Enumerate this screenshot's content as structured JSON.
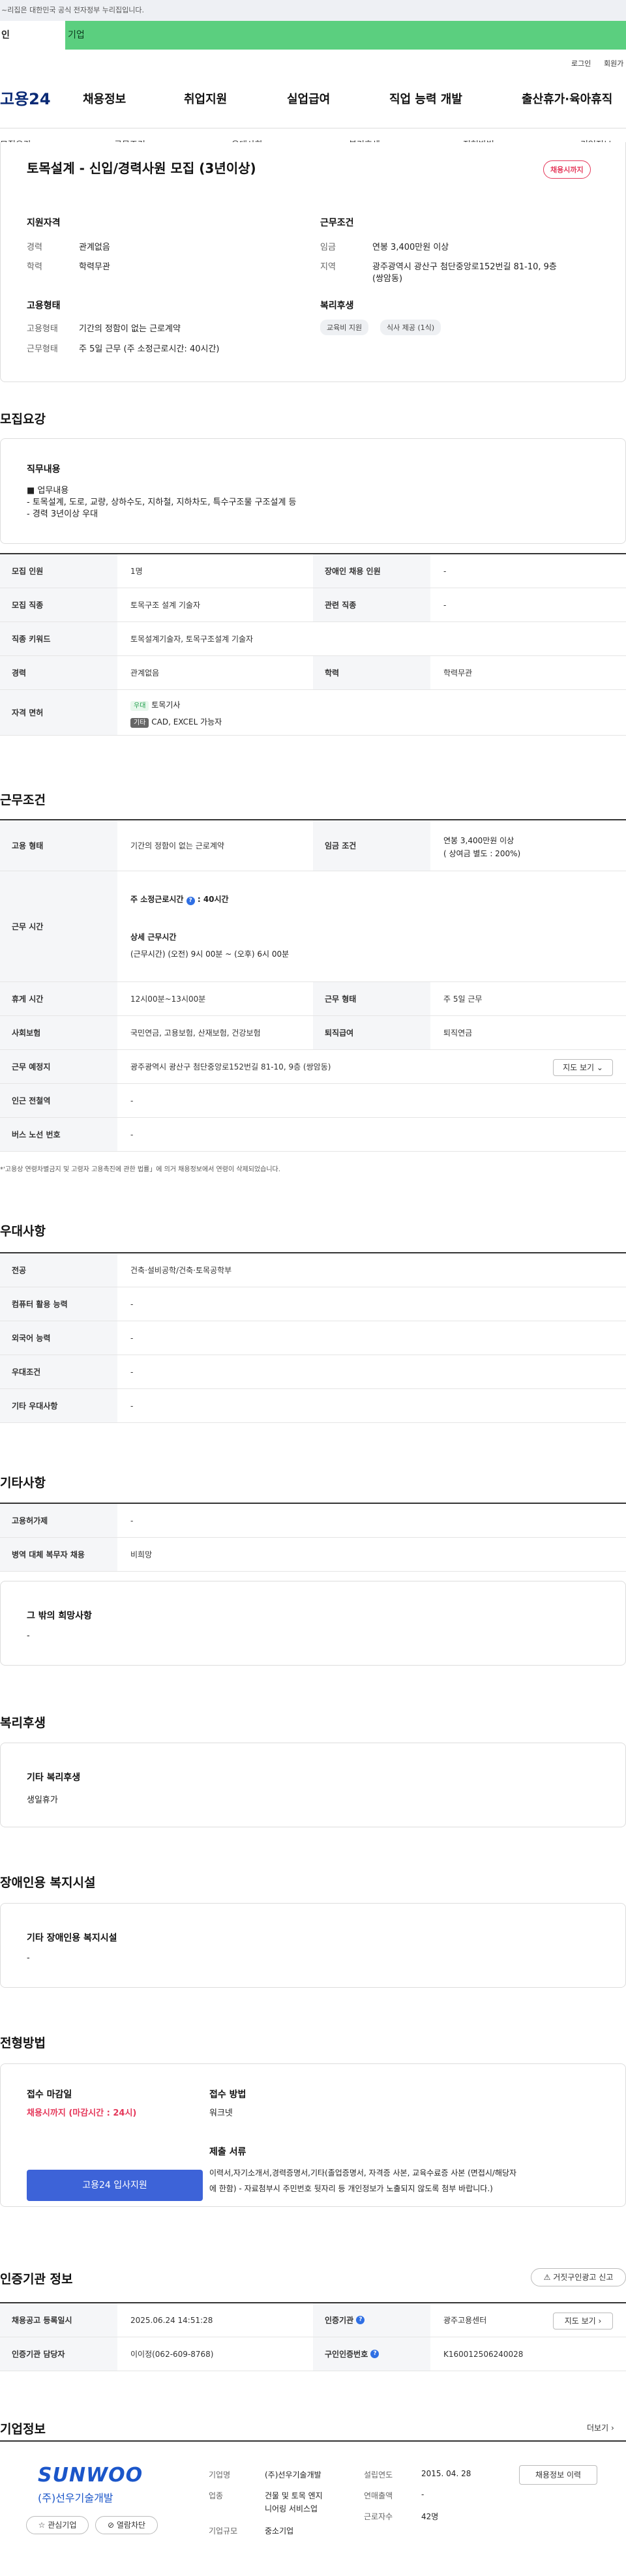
{
  "banner": {
    "text": "~리집은 대한민국 공식 전자정부 누리집입니다."
  },
  "tabs": {
    "t1": "인",
    "t2": "기업"
  },
  "util": {
    "login": "로그인",
    "join": "회원가"
  },
  "gnb": {
    "logo": "고용24",
    "items": [
      "채용정보",
      "취업지원",
      "실업급여",
      "직업 능력 개발",
      "출산휴가·육아휴직"
    ]
  },
  "subnav": [
    "모집요강",
    "근무조건",
    "우대사항",
    "복리후생",
    "전형방법",
    "기업정보"
  ],
  "summary": {
    "title": "토목설계 - 신입/경력사원 모집 (3년이상)",
    "badge": "채용시까지",
    "qual": {
      "h": "지원자격",
      "k1": "경력",
      "v1": "관계없음",
      "k2": "학력",
      "v2": "학력무관"
    },
    "cond": {
      "h": "근무조건",
      "k1": "임금",
      "v1": "연봉 3,400만원 이상",
      "k2": "지역",
      "v2a": "광주광역시 광산구 첨단중앙로152번길 81-10, 9층",
      "v2b": "(쌍암동)"
    },
    "emp": {
      "h": "고용형태",
      "k1": "고용형태",
      "v1": "기간의 정함이 없는 근로계약",
      "k2": "근무형태",
      "v2": "주 5일 근무 (주 소정근로시간: 40시간)"
    },
    "welfare": {
      "h": "복리후생",
      "c1": "교육비 지원",
      "c2": "식사 제공 (1식)"
    }
  },
  "recruit": {
    "h": "모집요강",
    "duty_h": "직무내용",
    "duty_l1": "업무내용",
    "duty_l2": "- 토목설계, 도로, 교량, 상하수도, 지하철, 지하차도, 특수구조물 구조설계 등",
    "duty_l3": "- 경력 3년이상 우대",
    "rows": {
      "r1": {
        "k1": "모집 인원",
        "v1": "1명",
        "k2": "장애인 채용 인원",
        "v2": "-"
      },
      "r2": {
        "k1": "모집 직종",
        "v1": "토목구조 설계 기술자",
        "k2": "관련 직종",
        "v2": "-"
      },
      "r3": {
        "k": "직종 키워드",
        "v": "토목설계기술자, 토목구조설계 기술자"
      },
      "r4": {
        "k1": "경력",
        "v1": "관계없음",
        "k2": "학력",
        "v2": "학력무관"
      },
      "r5": {
        "k": "자격 면허",
        "tag1": "우대",
        "cert": "토목기사",
        "tag2": "기타",
        "etc": "CAD, EXCEL 가능자"
      }
    }
  },
  "work": {
    "h": "근무조건",
    "r1": {
      "k1": "고용 형태",
      "v1": "기간의 정함이 없는 근로계약",
      "k2": "임금 조건",
      "v2a": "연봉 3,400만원 이상",
      "v2b": "( 상여금 별도 : 200%)"
    },
    "r2": {
      "k": "근무 시간",
      "a": "주 소정근로시간",
      "a2": ": 40시간",
      "b": "상세 근무시간",
      "c": "(근무시간) (오전) 9시 00분 ~ (오후) 6시 00분"
    },
    "r3": {
      "k1": "휴게 시간",
      "v1": "12시00분~13시00분",
      "k2": "근무 형태",
      "v2": "주 5일 근무"
    },
    "r4": {
      "k1": "사회보험",
      "v1": "국민연금, 고용보험, 산재보험, 건강보험",
      "k2": "퇴직급여",
      "v2": "퇴직연금"
    },
    "r5": {
      "k": "근무 예정지",
      "v": "광주광역시 광산구 첨단중앙로152번길 81-10, 9층 (쌍암동)",
      "btn": "지도 보기"
    },
    "r6": {
      "k": "인근 전철역",
      "v": "-"
    },
    "r7": {
      "k": "버스 노선 번호",
      "v": "-"
    },
    "note": "*'고용상 연령차별금지 및 고령자 고용촉진에 관한 법률」에 의거 채용정보에서 연령이 삭제되었습니다."
  },
  "pref": {
    "h": "우대사항",
    "rows": [
      {
        "k": "전공",
        "v": "건축·설비공학/건축·토목공학부"
      },
      {
        "k": "컴퓨터 활용 능력",
        "v": "-"
      },
      {
        "k": "외국어 능력",
        "v": "-"
      },
      {
        "k": "우대조건",
        "v": "-"
      },
      {
        "k": "기타 우대사항",
        "v": "-"
      }
    ]
  },
  "other": {
    "h": "기타사항",
    "rows": [
      {
        "k": "고용허가제",
        "v": "-"
      },
      {
        "k": "병역 대체 복무자 채용",
        "v": "비희망"
      }
    ],
    "box_h": "그 밖의 희망사항",
    "box_v": "-"
  },
  "benefit": {
    "h": "복리후생",
    "box_h": "기타 복리후생",
    "box_v": "생일휴가"
  },
  "facility": {
    "h": "장애인용 복지시설",
    "box_h": "기타 장애인용 복지시설",
    "box_v": "-"
  },
  "process": {
    "h": "전형방법",
    "dl_h": "접수 마감일",
    "dl_v": "채용시까지 (마감시간 : 24시)",
    "apply": "고용24 입사지원",
    "m_h": "접수 방법",
    "m_v": "워크넷",
    "d_h": "제출 서류",
    "d_v1": "이력서,자기소개서,경력증명서,기타(졸업증명서, 자격증 사본, 교육수료증 사본 (면접시/해당자",
    "d_v2": "에 한함) - 자료첨부시 주민번호 뒷자리 등 개인정보가 노출되지 않도록 첨부 바랍니다.)"
  },
  "cert": {
    "h": "인증기관 정보",
    "report": "거짓구인광고 신고",
    "r1": {
      "k1": "채용공고 등록일시",
      "v1": "2025.06.24 14:51:28",
      "k2": "인증기관",
      "v2": "광주고용센터",
      "btn": "지도 보기"
    },
    "r2": {
      "k1": "인증기관 담당자",
      "v1": "이이정(062-609-8768)",
      "k2": "구인인증번호",
      "v2": "K160012506240028"
    }
  },
  "company": {
    "h": "기업정보",
    "more": "더보기",
    "logo_en": "SUNWOO",
    "logo_ko": "(주)선우기술개발",
    "fav": "관심기업",
    "block": "열람차단",
    "k1": "기업명",
    "v1": "(주)선우기술개발",
    "k2": "업종",
    "v2a": "건물 및 토목 엔지",
    "v2b": "니어링 서비스업",
    "k3": "기업규모",
    "v3": "중소기업",
    "k4": "설립연도",
    "v4": "2015. 04. 28",
    "k5": "연매출액",
    "v5": "-",
    "k6": "근로자수",
    "v6": "42명",
    "btn": "채용정보 이력"
  }
}
